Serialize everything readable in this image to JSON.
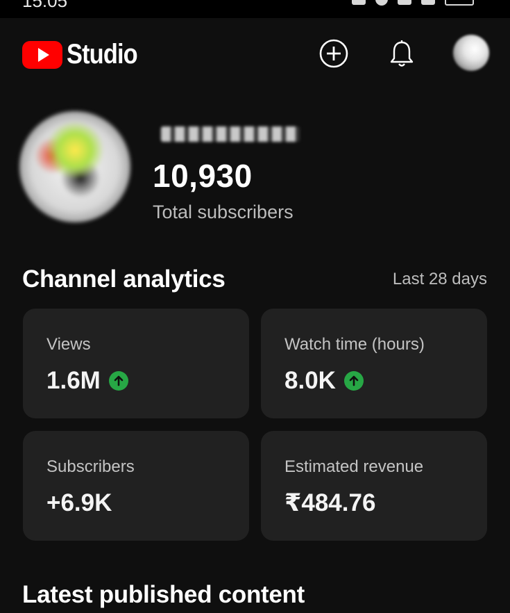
{
  "status_bar": {
    "time": "15:05"
  },
  "header": {
    "logo_text": "Studio",
    "brand_color": "#ff0000",
    "icons": [
      "create-icon",
      "bell-icon",
      "account-avatar"
    ]
  },
  "channel": {
    "subscriber_count": "10,930",
    "subscriber_label": "Total subscribers"
  },
  "analytics": {
    "title": "Channel analytics",
    "period": "Last 28 days",
    "cards": [
      {
        "label": "Views",
        "value": "1.6M",
        "trend": "up"
      },
      {
        "label": "Watch time (hours)",
        "value": "8.0K",
        "trend": "up"
      },
      {
        "label": "Subscribers",
        "value": "+6.9K"
      },
      {
        "label": "Estimated revenue",
        "value": "₹484.76"
      }
    ],
    "trend_color": "#27a745"
  },
  "latest": {
    "title": "Latest published content"
  }
}
